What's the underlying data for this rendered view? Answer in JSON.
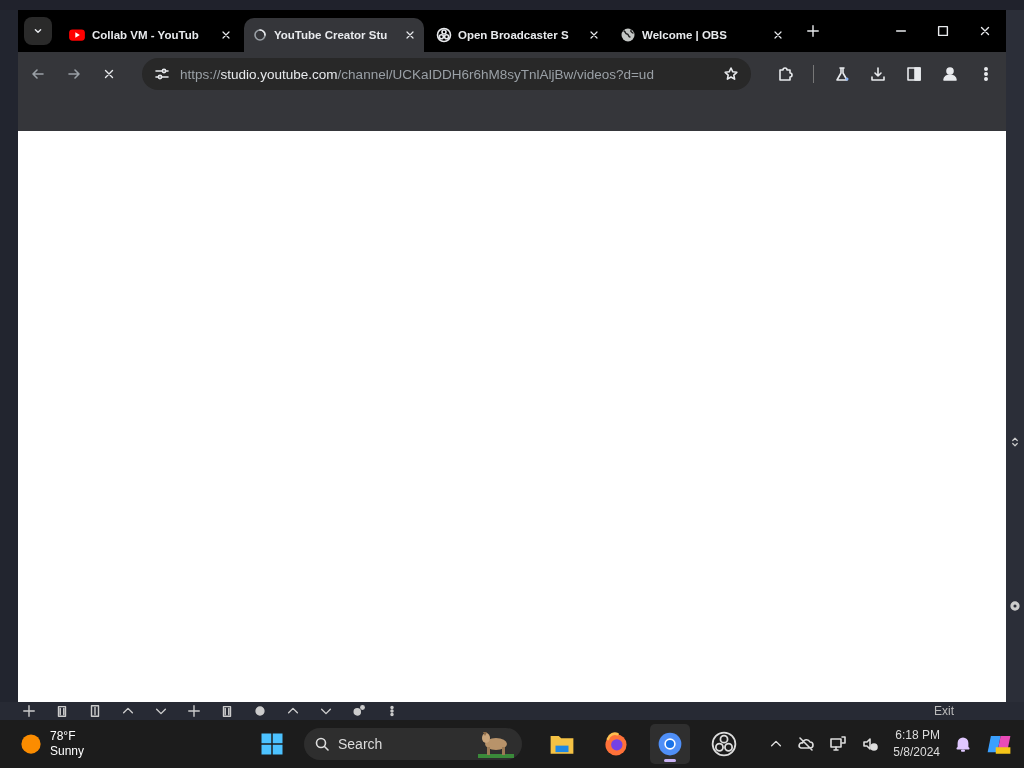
{
  "browser": {
    "tabs": [
      {
        "kind": "youtube",
        "title": "Collab VM - YouTub",
        "selected": false
      },
      {
        "kind": "loading",
        "title": "YouTube Creator Stu",
        "selected": true
      },
      {
        "kind": "obs",
        "title": "Open Broadcaster S",
        "selected": false
      },
      {
        "kind": "globe",
        "title": "Welcome | OBS",
        "selected": false
      }
    ],
    "address": {
      "scheme": "https://",
      "host": "studio.youtube.com",
      "path": "/channel/UCKaIDDH6r6hM8syTnlAljBw/videos?d=ud"
    }
  },
  "obs_dock": {
    "exit_label": "Exit"
  },
  "taskbar": {
    "weather": {
      "temperature": "78°F",
      "condition": "Sunny"
    },
    "search": {
      "placeholder": "Search"
    },
    "apps": [
      {
        "kind": "files",
        "selected": false
      },
      {
        "kind": "firefox",
        "selected": false
      },
      {
        "kind": "chrome",
        "selected": true
      },
      {
        "kind": "obs",
        "selected": false
      }
    ],
    "time": "6:18 PM",
    "date": "5/8/2024"
  }
}
